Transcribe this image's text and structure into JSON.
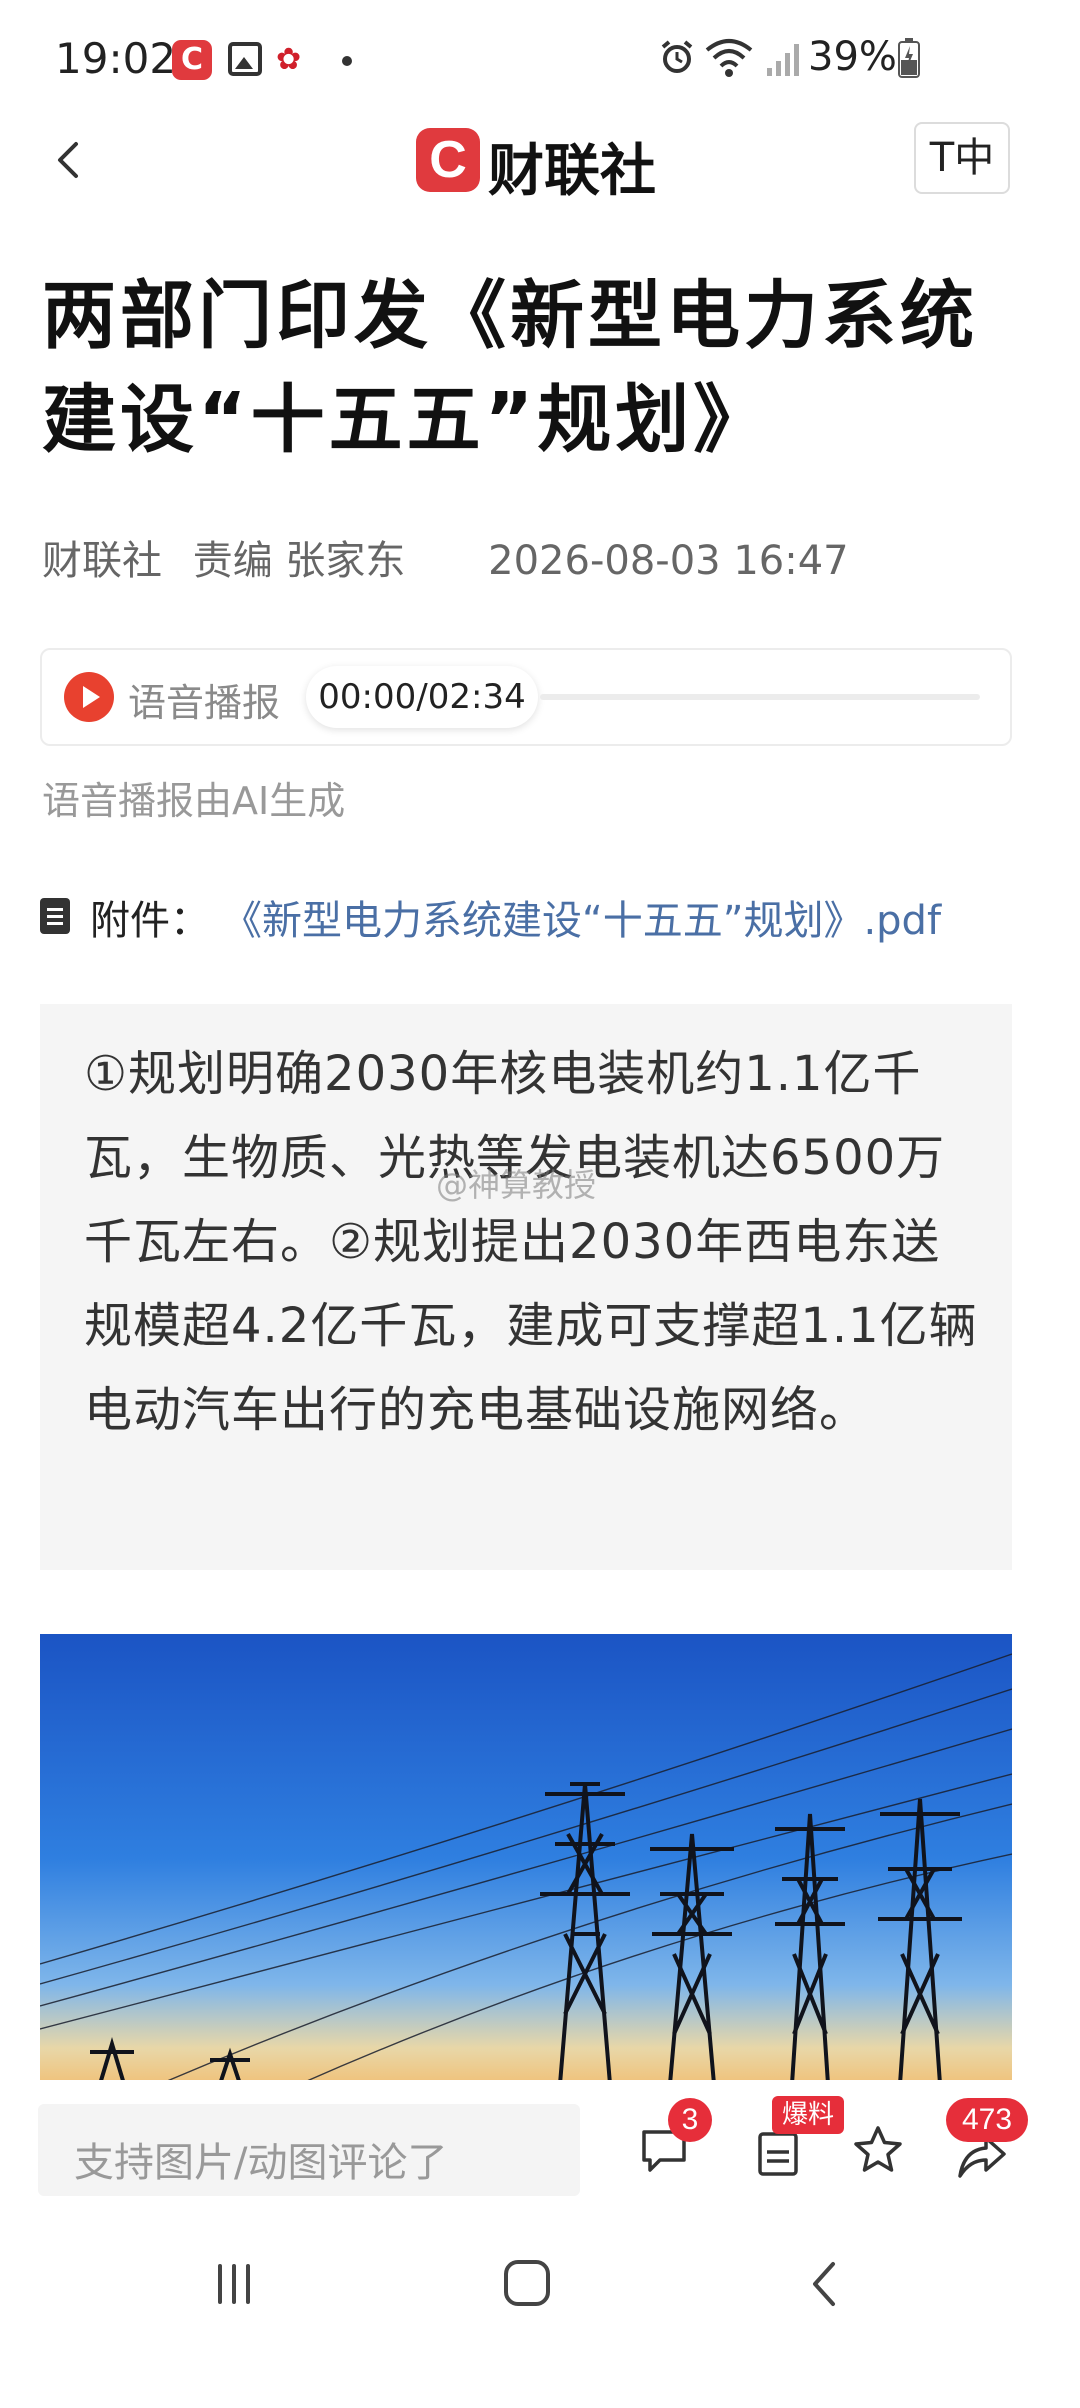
{
  "status_bar": {
    "time": "19:02",
    "battery_percent": "39%",
    "icons": [
      "cls-app-icon",
      "gallery-icon",
      "huawei-icon",
      "notification-dot",
      "alarm-icon",
      "wifi-icon",
      "signal-icon",
      "battery-icon"
    ]
  },
  "header": {
    "logo_letter": "C",
    "logo_text": "财联社",
    "font_button": "T中"
  },
  "article": {
    "title": "两部门印发《新型电力系统建设“十五五”规划》",
    "source": "财联社",
    "editor": "责编 张家东",
    "date": "2026-08-03 16:47"
  },
  "audio": {
    "label": "语音播报",
    "time": "00:00/02:34",
    "note": "语音播报由AI生成"
  },
  "attachment": {
    "label": "附件：",
    "file": "《新型电力系统建设“十五五”规划》.pdf"
  },
  "summary": {
    "text": "①规划明确2030年核电装机约1.1亿千瓦，生物质、光热等发电装机达6500万千瓦左右。②规划提出2030年西电东送规模超4.2亿千瓦，建成可支撑超1.1亿辆电动汽车出行的充电基础设施网络。",
    "watermark": "@神算教授"
  },
  "bottom_bar": {
    "comment_placeholder": "支持图片/动图评论了",
    "comment_count": "3",
    "report_label": "爆料",
    "share_count": "473"
  },
  "colors": {
    "brand_red": "#e03a3e",
    "link_blue": "#4a6fa5"
  }
}
